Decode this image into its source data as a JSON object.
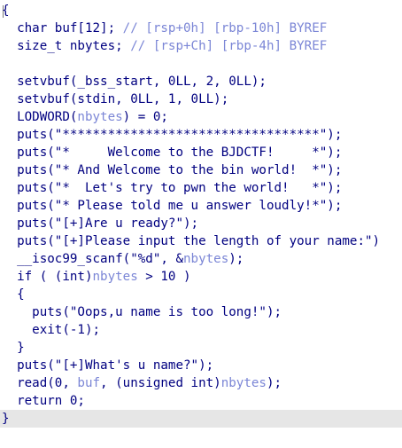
{
  "editor": {
    "lines": [
      [
        {
          "t": "{",
          "c": "kw"
        }
      ],
      [
        {
          "t": "  char buf[12]; ",
          "c": "kw"
        },
        {
          "t": "// [rsp+0h] [rbp-10h] BYREF",
          "c": "cm"
        }
      ],
      [
        {
          "t": "  size_t nbytes; ",
          "c": "kw"
        },
        {
          "t": "// [rsp+Ch] [rbp-4h] BYREF",
          "c": "cm"
        }
      ],
      [
        {
          "t": "",
          "c": "kw"
        }
      ],
      [
        {
          "t": "  setvbuf(_bss_start, 0LL, 2, 0LL);",
          "c": "kw"
        }
      ],
      [
        {
          "t": "  setvbuf(stdin, 0LL, 1, 0LL);",
          "c": "kw"
        }
      ],
      [
        {
          "t": "  LODWORD(",
          "c": "kw"
        },
        {
          "t": "nbytes",
          "c": "var"
        },
        {
          "t": ") = 0;",
          "c": "kw"
        }
      ],
      [
        {
          "t": "  puts(\"**********************************\");",
          "c": "kw"
        }
      ],
      [
        {
          "t": "  puts(\"*     Welcome to the BJDCTF!     *\");",
          "c": "kw"
        }
      ],
      [
        {
          "t": "  puts(\"* And Welcome to the bin world!  *\");",
          "c": "kw"
        }
      ],
      [
        {
          "t": "  puts(\"*  Let's try to pwn the world!   *\");",
          "c": "kw"
        }
      ],
      [
        {
          "t": "  puts(\"* Please told me u answer loudly!*\");",
          "c": "kw"
        }
      ],
      [
        {
          "t": "  puts(\"[+]Are u ready?\");",
          "c": "kw"
        }
      ],
      [
        {
          "t": "  puts(\"[+]Please input the length of your name:\")",
          "c": "kw"
        }
      ],
      [
        {
          "t": "  __isoc99_scanf(\"%d\", &",
          "c": "kw"
        },
        {
          "t": "nbytes",
          "c": "var"
        },
        {
          "t": ");",
          "c": "kw"
        }
      ],
      [
        {
          "t": "  if ( (int)",
          "c": "kw"
        },
        {
          "t": "nbytes",
          "c": "var"
        },
        {
          "t": " > 10 )",
          "c": "kw"
        }
      ],
      [
        {
          "t": "  {",
          "c": "kw"
        }
      ],
      [
        {
          "t": "    puts(\"Oops,u name is too long!\");",
          "c": "kw"
        }
      ],
      [
        {
          "t": "    exit(-1);",
          "c": "kw"
        }
      ],
      [
        {
          "t": "  }",
          "c": "kw"
        }
      ],
      [
        {
          "t": "  puts(\"[+]What's u name?\");",
          "c": "kw"
        }
      ],
      [
        {
          "t": "  read(0, ",
          "c": "kw"
        },
        {
          "t": "buf",
          "c": "var"
        },
        {
          "t": ", (unsigned int)",
          "c": "kw"
        },
        {
          "t": "nbytes",
          "c": "var"
        },
        {
          "t": ");",
          "c": "kw"
        }
      ],
      [
        {
          "t": "  return 0;",
          "c": "kw"
        }
      ],
      [
        {
          "t": "}",
          "c": "kw"
        }
      ]
    ],
    "highlighted_line": 23
  }
}
